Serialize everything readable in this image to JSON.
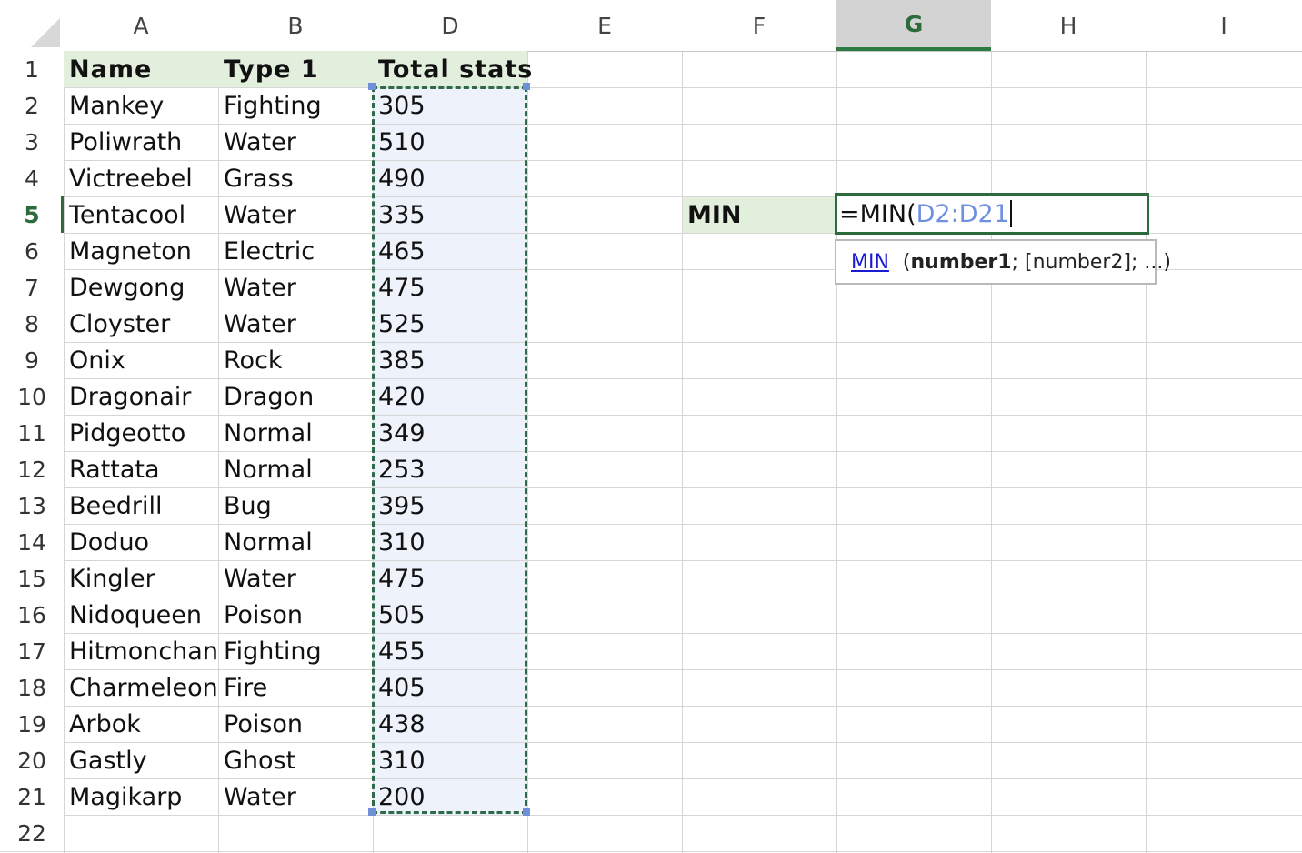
{
  "columns": [
    "A",
    "B",
    "D",
    "E",
    "F",
    "G",
    "H",
    "I"
  ],
  "active_column": "G",
  "active_row": "5",
  "rows": [
    {
      "n": "1",
      "name": "Name",
      "type": "Type 1",
      "total": "Total stats"
    },
    {
      "n": "2",
      "name": "Mankey",
      "type": "Fighting",
      "total": "305"
    },
    {
      "n": "3",
      "name": "Poliwrath",
      "type": "Water",
      "total": "510"
    },
    {
      "n": "4",
      "name": "Victreebel",
      "type": "Grass",
      "total": "490"
    },
    {
      "n": "5",
      "name": "Tentacool",
      "type": "Water",
      "total": "335"
    },
    {
      "n": "6",
      "name": "Magneton",
      "type": "Electric",
      "total": "465"
    },
    {
      "n": "7",
      "name": "Dewgong",
      "type": "Water",
      "total": "475"
    },
    {
      "n": "8",
      "name": "Cloyster",
      "type": "Water",
      "total": "525"
    },
    {
      "n": "9",
      "name": "Onix",
      "type": "Rock",
      "total": "385"
    },
    {
      "n": "10",
      "name": "Dragonair",
      "type": "Dragon",
      "total": "420"
    },
    {
      "n": "11",
      "name": "Pidgeotto",
      "type": "Normal",
      "total": "349"
    },
    {
      "n": "12",
      "name": "Rattata",
      "type": "Normal",
      "total": "253"
    },
    {
      "n": "13",
      "name": "Beedrill",
      "type": "Bug",
      "total": "395"
    },
    {
      "n": "14",
      "name": "Doduo",
      "type": "Normal",
      "total": "310"
    },
    {
      "n": "15",
      "name": "Kingler",
      "type": "Water",
      "total": "475"
    },
    {
      "n": "16",
      "name": "Nidoqueen",
      "type": "Poison",
      "total": "505"
    },
    {
      "n": "17",
      "name": "Hitmonchan",
      "type": "Fighting",
      "total": "455"
    },
    {
      "n": "18",
      "name": "Charmeleon",
      "type": "Fire",
      "total": "405"
    },
    {
      "n": "19",
      "name": "Arbok",
      "type": "Poison",
      "total": "438"
    },
    {
      "n": "20",
      "name": "Gastly",
      "type": "Ghost",
      "total": "310"
    },
    {
      "n": "21",
      "name": "Magikarp",
      "type": "Water",
      "total": "200"
    },
    {
      "n": "22",
      "name": "",
      "type": "",
      "total": ""
    }
  ],
  "label_cell": {
    "text": "MIN"
  },
  "formula": {
    "prefix": "=MIN(",
    "reference": "D2:D21"
  },
  "tooltip": {
    "function_name": "MIN",
    "open": " (",
    "arg1": "number1",
    "rest": "; [number2]; ...)"
  },
  "colors": {
    "header_fill": "#e1efdc",
    "range_fill": "#eef2fb",
    "reference_text": "#6f8fe0",
    "active_border": "#2e6b3c"
  }
}
